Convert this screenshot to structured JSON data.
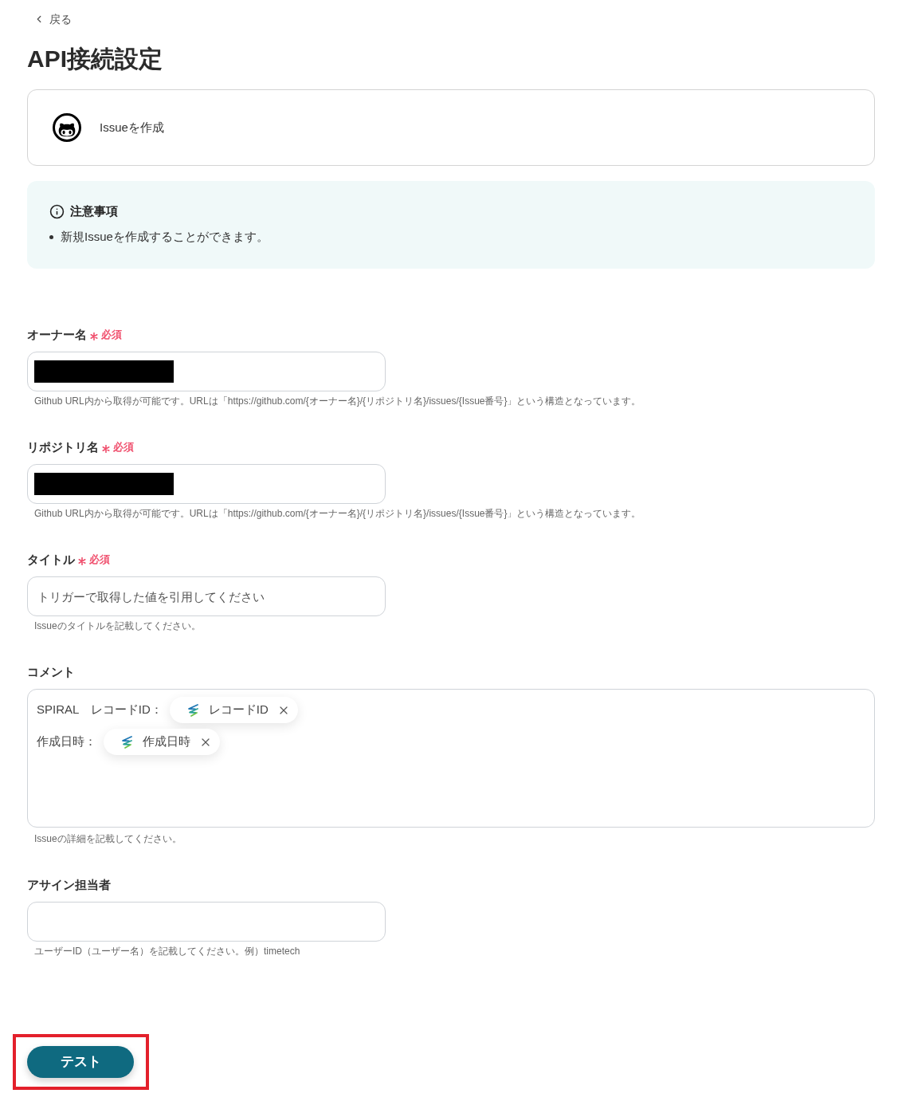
{
  "back_link": {
    "label": "戻る"
  },
  "page_title": "API接続設定",
  "action_card": {
    "label": "Issueを作成"
  },
  "notice": {
    "title": "注意事項",
    "items": [
      "新規Issueを作成することができます。"
    ]
  },
  "fields": [
    {
      "kind": "input",
      "label": "オーナー名",
      "required": true,
      "required_label": "必須",
      "redacted": true,
      "help": "Github URL内から取得が可能です。URLは「https://github.com/{オーナー名}/{リポジトリ名}/issues/{Issue番号}」という構造となっています。"
    },
    {
      "kind": "input",
      "label": "リポジトリ名",
      "required": true,
      "required_label": "必須",
      "redacted": true,
      "help": "Github URL内から取得が可能です。URLは「https://github.com/{オーナー名}/{リポジトリ名}/issues/{Issue番号}」という構造となっています。"
    },
    {
      "kind": "input",
      "label": "タイトル",
      "required": true,
      "required_label": "必須",
      "placeholder": "トリガーで取得した値を引用してください",
      "help": "Issueのタイトルを記載してください。"
    },
    {
      "kind": "textarea",
      "label": "コメント",
      "required": false,
      "lines": [
        [
          {
            "kind": "text",
            "text": "SPIRAL　レコードID："
          },
          {
            "kind": "chip",
            "text": "レコードID"
          }
        ],
        [
          {
            "kind": "text",
            "text": "作成日時："
          },
          {
            "kind": "chip",
            "text": "作成日時"
          }
        ]
      ],
      "help": "Issueの詳細を記載してください。"
    },
    {
      "kind": "input",
      "label": "アサイン担当者",
      "required": false,
      "help": "ユーザーID（ユーザー名）を記載してください。例）timetech"
    }
  ],
  "test_button": {
    "label": "テスト",
    "highlighted": true
  }
}
